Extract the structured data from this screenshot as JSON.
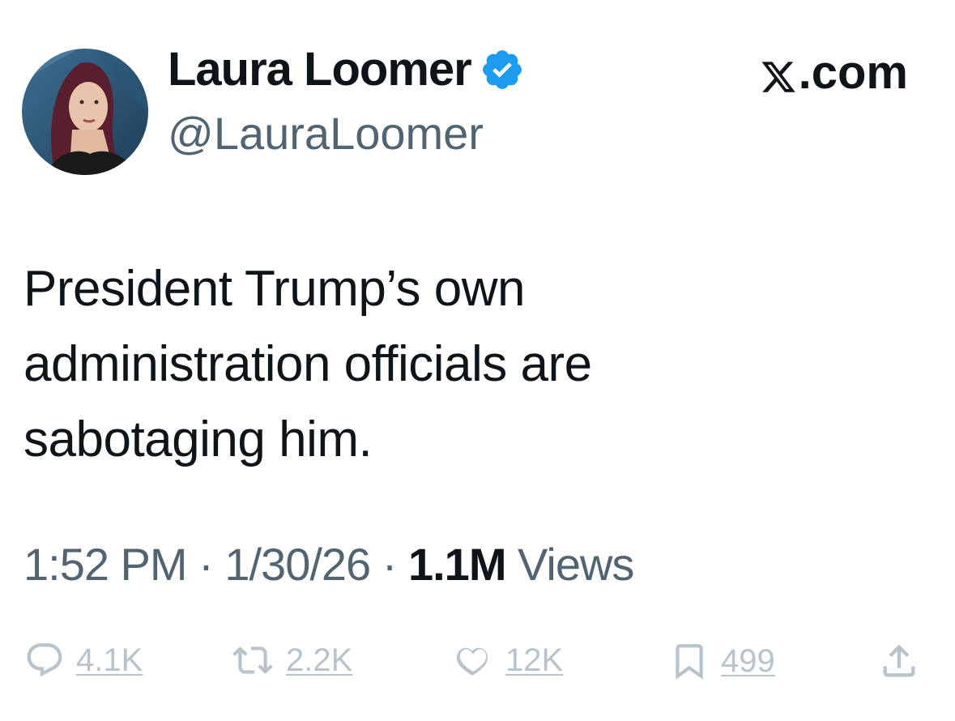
{
  "author": {
    "display_name": "Laura Loomer",
    "handle": "@LauraLoomer",
    "verified_icon": "verified-badge-icon",
    "avatar": "avatar-photo"
  },
  "brand": {
    "logo_icon": "x-logo-icon",
    "label": ".com"
  },
  "tweet": {
    "lines": [
      "President Trump’s own",
      "administration officials are",
      "sabotaging him."
    ]
  },
  "meta": {
    "time": "1:52 PM",
    "separator": "·",
    "date": "1/30/26",
    "views_count": "1.1M",
    "views_label": "Views"
  },
  "actions": {
    "reply": {
      "icon": "reply-icon",
      "count": "4.1K"
    },
    "repost": {
      "icon": "repost-icon",
      "count": "2.2K"
    },
    "like": {
      "icon": "heart-icon",
      "count": "12K"
    },
    "bookmark": {
      "icon": "bookmark-icon",
      "count": "499"
    },
    "share": {
      "icon": "share-icon"
    }
  },
  "colors": {
    "text": "#0f1419",
    "secondary": "#536471",
    "faded_actions": "#b9c3cb",
    "verified_blue": "#1d9bf0"
  }
}
